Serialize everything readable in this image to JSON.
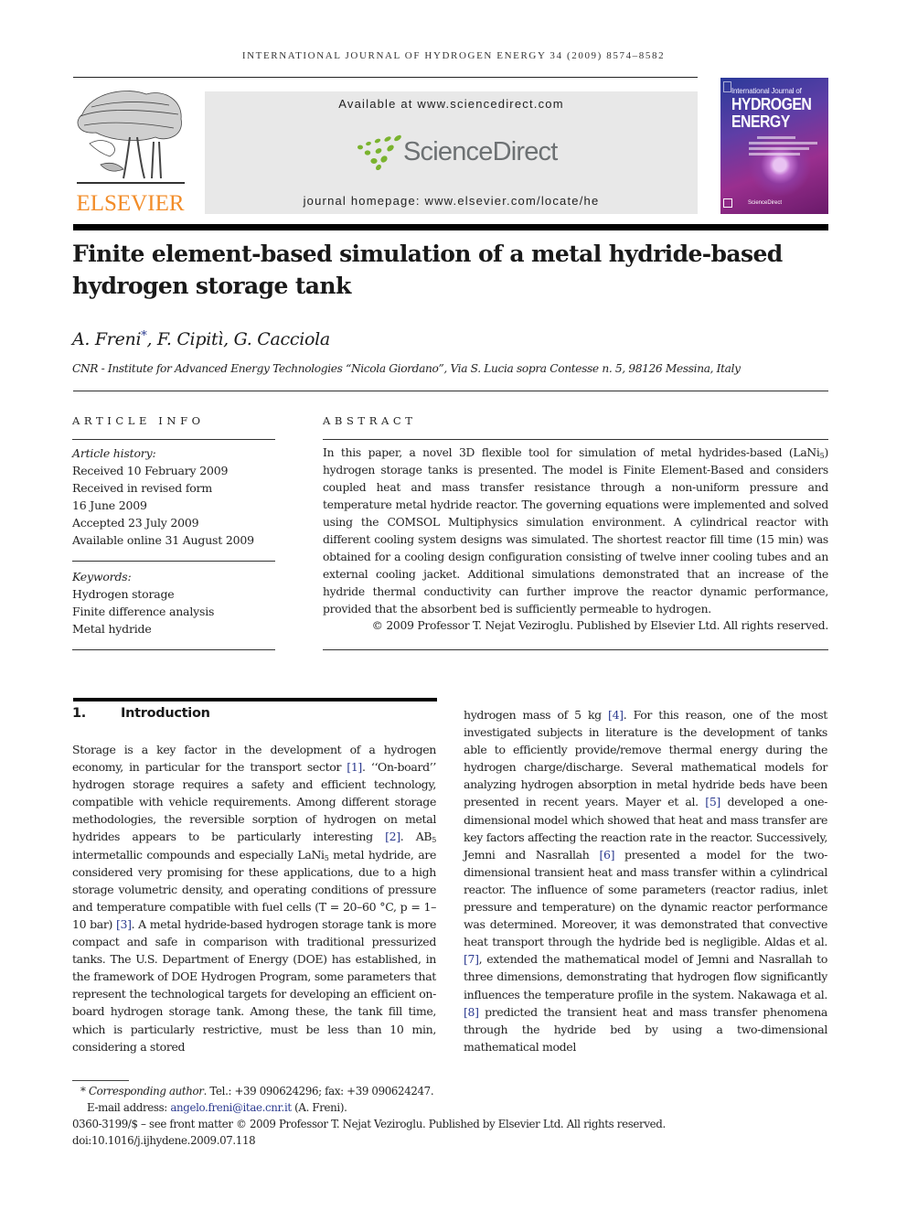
{
  "running_head": "INTERNATIONAL JOURNAL OF HYDROGEN ENERGY 34 (2009) 8574–8582",
  "publisher": {
    "logo_text": "ELSEVIER",
    "logo_color": "#f28c28"
  },
  "sciencedirect_banner": {
    "available": "Available at www.sciencedirect.com",
    "logo_text": "ScienceDirect",
    "logo_dot_color": "#7ab32e",
    "homepage": "journal homepage: www.elsevier.com/locate/he"
  },
  "journal_cover": {
    "line1": "International Journal of",
    "line2": "HYDROGEN",
    "line3": "ENERGY",
    "footer": "ScienceDirect"
  },
  "article": {
    "title": "Finite element-based simulation of a metal hydride-based hydrogen storage tank",
    "authors": "A. Freni, F. Cipitì, G. Cacciola",
    "author_parts": [
      "A. Freni",
      "*",
      ", F. Cipitì, G. Cacciola"
    ],
    "affiliation": "CNR - Institute for Advanced Energy Technologies “Nicola Giordano”, Via S. Lucia sopra Contesse n. 5, 98126 Messina, Italy"
  },
  "article_info": {
    "label": "ARTICLE INFO",
    "history_label": "Article history:",
    "history": [
      "Received 10 February 2009",
      "Received in revised form",
      "16 June 2009",
      "Accepted 23 July 2009",
      "Available online 31 August 2009"
    ],
    "keywords_label": "Keywords:",
    "keywords": [
      "Hydrogen storage",
      "Finite difference analysis",
      "Metal hydride"
    ]
  },
  "abstract": {
    "label": "ABSTRACT",
    "text_before_sub": "In this paper, a novel 3D flexible tool for simulation of metal hydrides-based (LaNi",
    "sub": "5",
    "text_after_sub": ") hydrogen storage tanks is presented. The model is Finite Element-Based and considers coupled heat and mass transfer resistance through a non-uniform pressure and temperature metal hydride reactor. The governing equations were implemented and solved using the COMSOL Multiphysics simulation environment. A cylindrical reactor with different cooling system designs was simulated. The shortest reactor fill time (15 min) was obtained for a cooling design configuration consisting of twelve inner cooling tubes and an external cooling jacket. Additional simulations demonstrated that an increase of the hydride thermal conductivity can further improve the reactor dynamic performance, provided that the absorbent bed is sufficiently permeable to hydrogen.",
    "copyright": "© 2009 Professor T. Nejat Veziroglu. Published by Elsevier Ltd. All rights reserved."
  },
  "introduction": {
    "number": "1.",
    "heading": "Introduction",
    "left": {
      "p1": "Storage is a key factor in the development of a hydrogen economy, in particular for the transport sector ",
      "c1": "[1]",
      "p2": ". ‘‘On-board’’ hydrogen storage requires a safety and efficient technology, compatible with vehicle requirements. Among different storage methodologies, the reversible sorption of hydrogen on metal hydrides appears to be particularly interesting ",
      "c2": "[2]",
      "p3": ". AB",
      "sub1": "5",
      "p4": " intermetallic compounds and especially LaNi",
      "sub2": "5",
      "p5": " metal hydride, are considered very promising for these applications, due to a high storage volumetric density, and operating conditions of pressure and temperature compatible with fuel cells (T = 20–60 °C, p = 1–10 bar) ",
      "c3": "[3]",
      "p6": ". A metal hydride-based hydrogen storage tank is more compact and safe in comparison with traditional pressurized tanks. The U.S. Department of Energy (DOE) has established, in the framework of DOE Hydrogen Program, some parameters that represent the technological targets for developing an efficient on-board hydrogen storage tank. Among these, the tank fill time, which is particularly restrictive, must be less than 10 min, considering a stored"
    },
    "right": {
      "p1": "hydrogen mass of 5 kg ",
      "c4": "[4]",
      "p2": ". For this reason, one of the most investigated subjects in literature is the development of tanks able to efficiently provide/remove thermal energy during the hydrogen charge/discharge. Several mathematical models for analyzing hydrogen absorption in metal hydride beds have been presented in recent years. Mayer et al. ",
      "c5": "[5]",
      "p3": " developed a one-dimensional model which showed that heat and mass transfer are key factors affecting the reaction rate in the reactor. Successively, Jemni and Nasrallah ",
      "c6": "[6]",
      "p4": " presented a model for the two-dimensional transient heat and mass transfer within a cylindrical reactor. The influence of some parameters (reactor radius, inlet pressure and temperature) on the dynamic reactor performance was determined. Moreover, it was demonstrated that convective heat transport through the hydride bed is negligible. Aldas et al. ",
      "c7": "[7]",
      "p5": ", extended the mathematical model of Jemni and Nasrallah to three dimensions, demonstrating that hydrogen flow significantly influences the temperature profile in the system. Nakawaga et al. ",
      "c8": "[8]",
      "p6": " predicted the transient heat and mass transfer phenomena through the hydride bed by using a two-dimensional mathematical model"
    }
  },
  "footnotes": {
    "star": "*",
    "corresponding_label": "Corresponding author",
    "contact": ". Tel.: +39 090624296; fax: +39 090624247.",
    "email_label": "E-mail address: ",
    "email": "angelo.freni@itae.cnr.it",
    "email_after": " (A. Freni).",
    "front_matter": "0360-3199/$ – see front matter © 2009 Professor T. Nejat Veziroglu. Published by Elsevier Ltd. All rights reserved.",
    "doi": "doi:10.1016/j.ijhydene.2009.07.118"
  },
  "colors": {
    "link": "#2b3a8f",
    "elsevier_orange": "#f28c28",
    "sd_green": "#7ab32e"
  }
}
